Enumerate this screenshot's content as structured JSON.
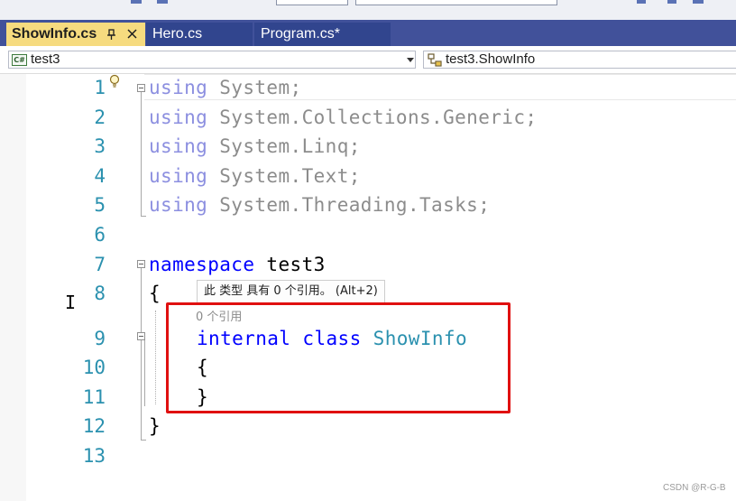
{
  "tabs": {
    "active": {
      "label": "ShowInfo.cs",
      "pin_icon": "pin-icon",
      "close_icon": "close-icon"
    },
    "others": [
      {
        "label": "Hero.cs"
      },
      {
        "label": "Program.cs*"
      }
    ]
  },
  "navbar": {
    "project": "test3",
    "project_badge": "C#",
    "type": "test3.ShowInfo"
  },
  "editor": {
    "line_numbers": [
      "1",
      "2",
      "3",
      "4",
      "5",
      "6",
      "7",
      "8",
      "9",
      "10",
      "11",
      "12",
      "13"
    ],
    "code": {
      "line1": {
        "kw": "using",
        "rest": " System;"
      },
      "line2": {
        "kw": "using",
        "rest": " System.Collections.Generic;"
      },
      "line3": {
        "kw": "using",
        "rest": " System.Linq;"
      },
      "line4": {
        "kw": "using",
        "rest": " System.Text;"
      },
      "line5": {
        "kw": "using",
        "rest": " System.Threading.Tasks;"
      },
      "line7": {
        "kw": "namespace",
        "rest": " test3"
      },
      "line8": {
        "text": "{"
      },
      "line9": {
        "kw1": "internal",
        "kw2": "class",
        "name": "ShowInfo"
      },
      "line10": {
        "text": "{"
      },
      "line11": {
        "text": "}"
      },
      "line12": {
        "text": "}"
      }
    },
    "codelens": "0 个引用",
    "tooltip": "此 类型 具有 0 个引用。 (Alt+2)"
  },
  "watermark": "CSDN @R-G-B",
  "colors": {
    "tab_bar": "#41519a",
    "active_tab": "#f6db7f",
    "keyword": "#0000ff",
    "type_name": "#2b91af",
    "highlight": "#e01010"
  }
}
